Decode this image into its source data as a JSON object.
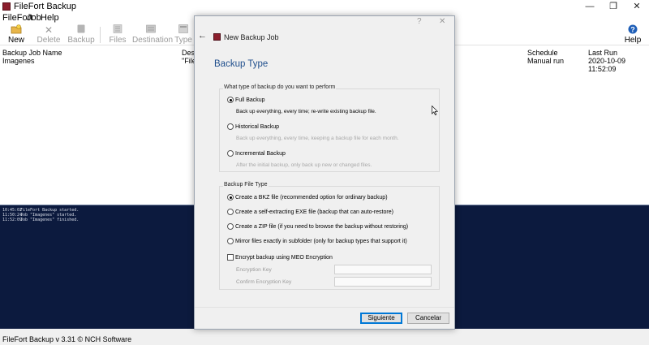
{
  "app": {
    "title": "FileFort Backup",
    "brand_color": "#8b1e2c",
    "window_controls": {
      "minimize": "—",
      "maximize": "❐",
      "close": "✕"
    }
  },
  "menu": [
    "FileFort",
    "Job",
    "Help"
  ],
  "toolbar": {
    "new": {
      "label": "New",
      "icon": "new-job-icon"
    },
    "delete": {
      "label": "Delete",
      "icon": "delete-icon"
    },
    "backup": {
      "label": "Backup",
      "icon": "backup-icon"
    },
    "files": {
      "label": "Files",
      "icon": "files-icon"
    },
    "destination": {
      "label": "Destination",
      "icon": "destination-icon"
    },
    "type": {
      "label": "Type",
      "icon": "type-icon"
    },
    "help": {
      "label": "Help",
      "icon": "help-icon"
    }
  },
  "job_list": {
    "columns": {
      "name": "Backup Job Name",
      "destination": "Desti",
      "schedule": "Schedule",
      "last_run": "Last Run"
    },
    "rows": [
      {
        "name": "Imagenes",
        "destination": "\"FileF",
        "schedule": "Manual run",
        "last_run": "2020-10-09 11:52:09"
      }
    ]
  },
  "log": [
    {
      "time": "10:45:02",
      "text": "FileFort Backup started."
    },
    {
      "time": "11:50:24",
      "text": "Job \"Imagenes\" started."
    },
    {
      "time": "11:52:09",
      "text": "Job \"Imagenes\" finished."
    }
  ],
  "status": {
    "text": "FileFort Backup v 3.31 © NCH Software"
  },
  "dialog": {
    "header_title": "New Backup Job",
    "help_glyph": "?",
    "close_glyph": "✕",
    "back_glyph": "←",
    "section_title": "Backup Type",
    "type_group": {
      "legend": "What type of backup do you want to perform",
      "options": [
        {
          "label": "Full Backup",
          "desc": "Back up everything, every time; re-write existing backup file.",
          "checked": true
        },
        {
          "label": "Historical Backup",
          "desc": "Back up everything, every time, keeping a backup file for each month.",
          "checked": false
        },
        {
          "label": "Incremental Backup",
          "desc": "After the initial backup, only back up new or changed files.",
          "checked": false
        }
      ]
    },
    "file_group": {
      "legend": "Backup File Type",
      "options": [
        {
          "label": "Create a BKZ file  (recommended option for ordinary backup)",
          "checked": true
        },
        {
          "label": "Create a self-extracting EXE file  (backup that can auto-restore)",
          "checked": false
        },
        {
          "label": "Create a ZIP file  (if you need to browse the backup without restoring)",
          "checked": false
        },
        {
          "label": "Mirror files exactly in subfolder  (only for backup types that support it)",
          "checked": false
        }
      ],
      "encrypt_label": "Encrypt backup using MEO Encryption",
      "encrypt_checked": false,
      "key_label": "Encryption Key",
      "confirm_label": "Confirm Encryption Key"
    },
    "buttons": {
      "next": "Siguiente",
      "cancel": "Cancelar"
    }
  }
}
